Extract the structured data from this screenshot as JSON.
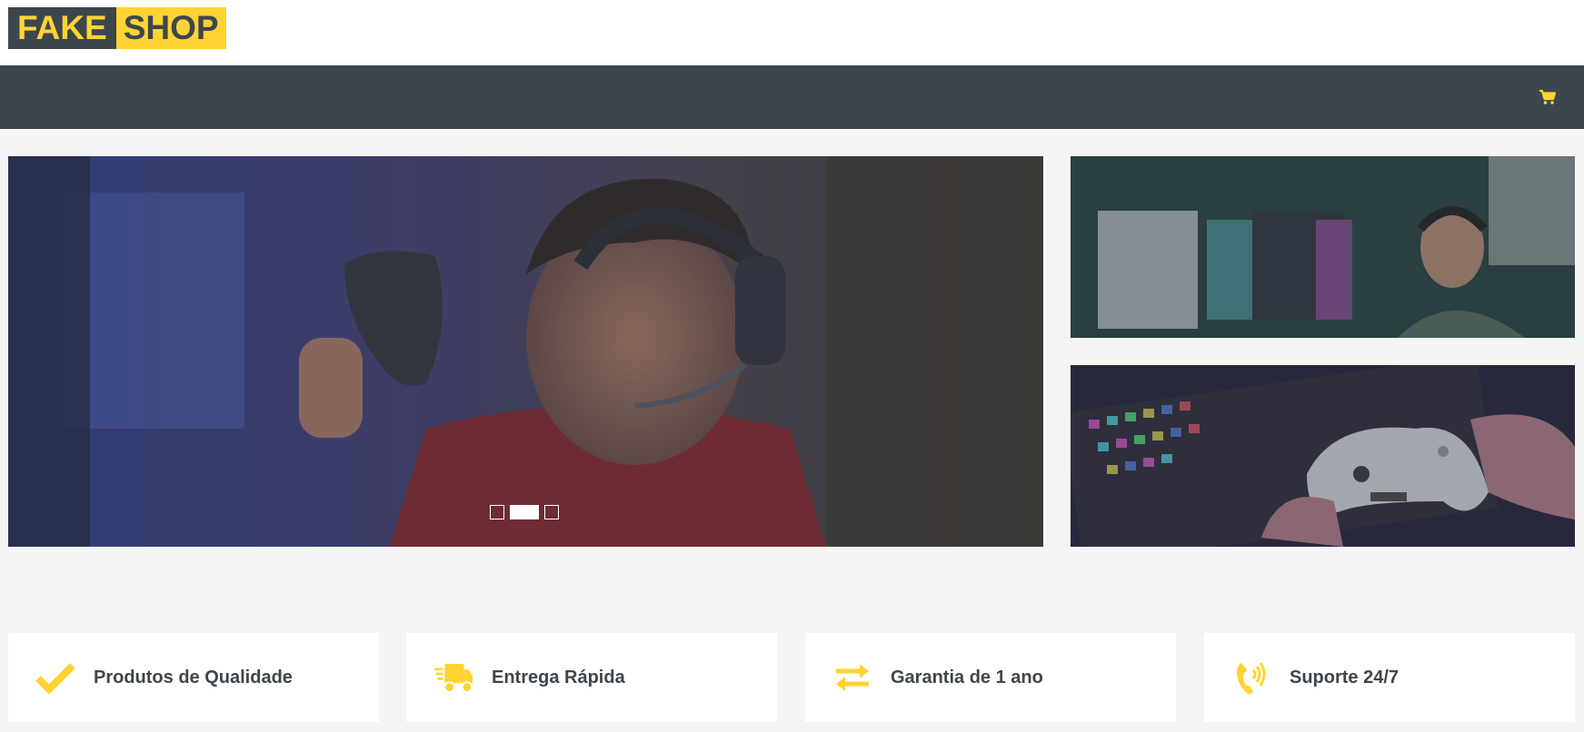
{
  "logo": {
    "part1": "FAKE",
    "part2": "SHOP"
  },
  "header": {
    "cart_icon": "shopping-cart-icon"
  },
  "carousel": {
    "slides": 3,
    "active_slide": 2
  },
  "features": [
    {
      "icon": "check-icon",
      "label": "Produtos de Qualidade"
    },
    {
      "icon": "truck-icon",
      "label": "Entrega Rápida"
    },
    {
      "icon": "exchange-arrows-icon",
      "label": "Garantia de 1 ano"
    },
    {
      "icon": "phone-volume-icon",
      "label": "Suporte 24/7"
    }
  ],
  "colors": {
    "brand_dark": "#3d464d",
    "brand_yellow": "#ffd333",
    "page_bg": "#f5f5f5"
  }
}
